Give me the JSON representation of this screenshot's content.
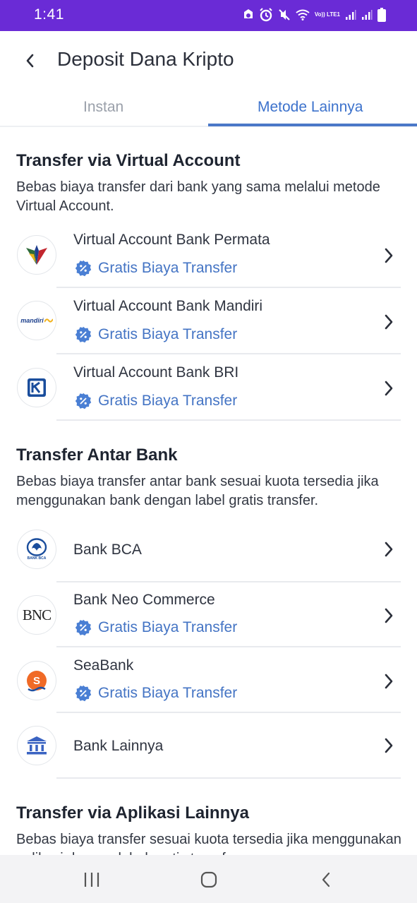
{
  "status_bar": {
    "time": "1:41",
    "network_label": "Vo)) LTE1"
  },
  "header": {
    "title": "Deposit Dana Kripto"
  },
  "tabs": [
    {
      "label": "Instan",
      "active": false
    },
    {
      "label": "Metode Lainnya",
      "active": true
    }
  ],
  "sections": [
    {
      "title": "Transfer via Virtual Account",
      "description": "Bebas biaya transfer dari bank yang sama melalui metode Virtual Account.",
      "items": [
        {
          "name": "Virtual Account Bank Permata",
          "badge": "Gratis Biaya Transfer",
          "logo": "permata-logo"
        },
        {
          "name": "Virtual Account Bank Mandiri",
          "badge": "Gratis Biaya Transfer",
          "logo": "mandiri-logo",
          "logo_text": "mandiri"
        },
        {
          "name": "Virtual Account Bank BRI",
          "badge": "Gratis Biaya Transfer",
          "logo": "bri-logo"
        }
      ]
    },
    {
      "title": "Transfer Antar Bank",
      "description": "Bebas biaya transfer antar bank sesuai kuota tersedia jika menggunakan bank dengan label gratis transfer.",
      "items": [
        {
          "name": "Bank BCA",
          "logo": "bca-logo",
          "logo_text": "BANK BCA"
        },
        {
          "name": "Bank Neo Commerce",
          "badge": "Gratis Biaya Transfer",
          "logo": "bnc-logo",
          "logo_text": "BNC"
        },
        {
          "name": "SeaBank",
          "badge": "Gratis Biaya Transfer",
          "logo": "seabank-logo",
          "logo_text": "S"
        },
        {
          "name": "Bank Lainnya",
          "logo": "bank-building-icon"
        }
      ]
    },
    {
      "title": "Transfer via Aplikasi Lainnya",
      "description": "Bebas biaya transfer sesuai kuota tersedia jika menggunakan aplikasi dengan label gratis transfer."
    }
  ],
  "colors": {
    "status_bar": "#6a2bd6",
    "accent": "#3c72cc",
    "badge_icon": "#4a7fd4"
  }
}
